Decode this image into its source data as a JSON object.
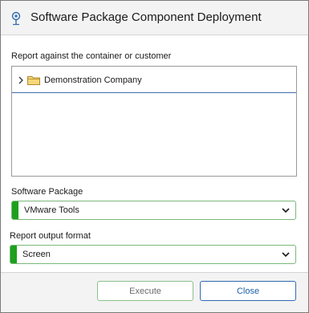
{
  "dialog": {
    "title": "Software Package Component Deployment",
    "title_icon": "location-pin-icon"
  },
  "report_against": {
    "label": "Report against the container or customer",
    "tree_items": [
      {
        "label": "Demonstration Company",
        "icon": "folder-icon",
        "expanded": false
      }
    ]
  },
  "software_package": {
    "label": "Software Package",
    "selected": "VMware Tools"
  },
  "output_format": {
    "label": "Report output format",
    "selected": "Screen"
  },
  "footer": {
    "execute_label": "Execute",
    "close_label": "Close"
  },
  "colors": {
    "accent_green": "#1ea01e",
    "close_blue": "#2f6bb0",
    "titlebar_bg": "#f3f3f3"
  }
}
